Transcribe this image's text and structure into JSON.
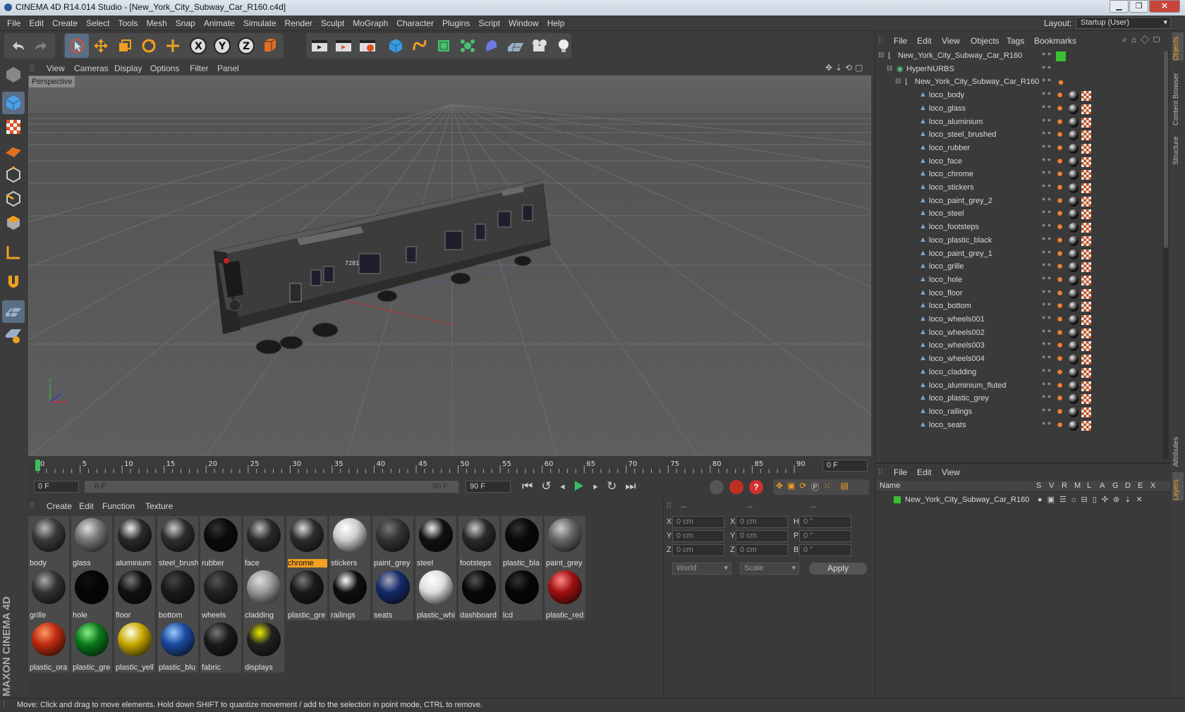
{
  "app": {
    "title": "CINEMA 4D R14.014 Studio - [New_York_City_Subway_Car_R160.c4d]",
    "layout_label": "Layout:",
    "layout_value": "Startup (User)"
  },
  "menu": [
    "File",
    "Edit",
    "Create",
    "Select",
    "Tools",
    "Mesh",
    "Snap",
    "Animate",
    "Simulate",
    "Render",
    "Sculpt",
    "MoGraph",
    "Character",
    "Plugins",
    "Script",
    "Window",
    "Help"
  ],
  "viewport": {
    "menu": [
      "View",
      "Cameras",
      "Display",
      "Options",
      "Filter",
      "Panel"
    ],
    "label": "Perspective",
    "car_number": "7281"
  },
  "timeline": {
    "ticks": [
      "0",
      "5",
      "10",
      "15",
      "20",
      "25",
      "30",
      "35",
      "40",
      "45",
      "50",
      "55",
      "60",
      "65",
      "70",
      "75",
      "80",
      "85",
      "90"
    ],
    "frame_field": "0 F",
    "start_field": "0 F",
    "range_start": "0 F",
    "range_end": "90 F",
    "end_field": "90 F"
  },
  "materials": {
    "menu": [
      "Create",
      "Edit",
      "Function",
      "Texture"
    ],
    "items": [
      {
        "label": "body",
        "color": "#3a3a3a",
        "shine": "#bbb"
      },
      {
        "label": "glass",
        "color": "#777",
        "shine": "#ddd"
      },
      {
        "label": "aluminium",
        "color": "#2a2a2a",
        "shine": "#eee"
      },
      {
        "label": "steel_brush",
        "color": "#2e2e2e",
        "shine": "#ccc"
      },
      {
        "label": "rubber",
        "color": "#0a0a0a",
        "shine": "#333"
      },
      {
        "label": "face",
        "color": "#2a2a2a",
        "shine": "#bbb"
      },
      {
        "label": "chrome",
        "color": "#2d2d2d",
        "shine": "#ddd",
        "selected": true
      },
      {
        "label": "stickers",
        "color": "#ccc",
        "shine": "#fff"
      },
      {
        "label": "paint_grey",
        "color": "#333",
        "shine": "#777"
      },
      {
        "label": "steel",
        "color": "#111",
        "shine": "#eee"
      },
      {
        "label": "footsteps",
        "color": "#2a2a2a",
        "shine": "#ccc"
      },
      {
        "label": "plastic_bla",
        "color": "#080808",
        "shine": "#333"
      },
      {
        "label": "paint_grey",
        "color": "#666",
        "shine": "#ccc"
      },
      {
        "label": "grille",
        "color": "#333",
        "shine": "#aaa"
      },
      {
        "label": "hole",
        "color": "#050505",
        "shine": "#111"
      },
      {
        "label": "floor",
        "color": "#111",
        "shine": "#777"
      },
      {
        "label": "bottom",
        "color": "#1a1a1a",
        "shine": "#444"
      },
      {
        "label": "wheels",
        "color": "#222",
        "shine": "#555"
      },
      {
        "label": "cladding",
        "color": "#999",
        "shine": "#ddd"
      },
      {
        "label": "plastic_gre",
        "color": "#1a1a1a",
        "shine": "#777"
      },
      {
        "label": "railings",
        "color": "#0e0e0e",
        "shine": "#fff"
      },
      {
        "label": "seats",
        "color": "#152a6a",
        "shine": "#aab"
      },
      {
        "label": "plastic_whi",
        "color": "#ddd",
        "shine": "#fff"
      },
      {
        "label": "dashboard",
        "color": "#080808",
        "shine": "#555"
      },
      {
        "label": "lcd",
        "color": "#050505",
        "shine": "#333"
      },
      {
        "label": "plastic_red",
        "color": "#a01010",
        "shine": "#f88"
      },
      {
        "label": "plastic_ora",
        "color": "#c02a10",
        "shine": "#f96"
      },
      {
        "label": "plastic_gre",
        "color": "#0a7a1a",
        "shine": "#8e8"
      },
      {
        "label": "plastic_yell",
        "color": "#c8a800",
        "shine": "#ffe"
      },
      {
        "label": "plastic_blu",
        "color": "#1a4aa0",
        "shine": "#9cf"
      },
      {
        "label": "fabric",
        "color": "#1a1a1a",
        "shine": "#777"
      },
      {
        "label": "displays",
        "color": "#222",
        "shine": "#ee0"
      }
    ]
  },
  "coords": {
    "header": "--",
    "col_headers": [
      "--",
      "--"
    ],
    "rows": [
      {
        "a": "X",
        "av": "0 cm",
        "b": "X",
        "bv": "0 cm",
        "c": "H",
        "cv": "0 °"
      },
      {
        "a": "Y",
        "av": "0 cm",
        "b": "Y",
        "bv": "0 cm",
        "c": "P",
        "cv": "0 °"
      },
      {
        "a": "Z",
        "av": "0 cm",
        "b": "Z",
        "bv": "0 cm",
        "c": "B",
        "cv": "0 °"
      }
    ],
    "world": "World",
    "scale": "Scale",
    "apply": "Apply"
  },
  "objects": {
    "menu": [
      "File",
      "Edit",
      "View",
      "Objects",
      "Tags",
      "Bookmarks"
    ],
    "root": "New_York_City_Subway_Car_R160",
    "hypernurbs": "HyperNURBS",
    "group": "New_York_City_Subway_Car_R160",
    "children": [
      "loco_body",
      "loco_glass",
      "loco_aluminium",
      "loco_steel_brushed",
      "loco_rubber",
      "loco_face",
      "loco_chrome",
      "loco_stickers",
      "loco_paint_grey_2",
      "loco_steel",
      "loco_footsteps",
      "loco_plastic_black",
      "loco_paint_grey_1",
      "loco_grille",
      "loco_hole",
      "loco_floor",
      "loco_bottom",
      "loco_wheels001",
      "loco_wheels002",
      "loco_wheels003",
      "loco_wheels004",
      "loco_cladding",
      "loco_aluminium_fluted",
      "loco_plastic_grey",
      "loco_railings",
      "loco_seats"
    ]
  },
  "layers": {
    "menu": [
      "File",
      "Edit",
      "View"
    ],
    "name_header": "Name",
    "cols": [
      "S",
      "V",
      "R",
      "M",
      "L",
      "A",
      "G",
      "D",
      "E",
      "X"
    ],
    "row": "New_York_City_Subway_Car_R160"
  },
  "side_tabs": [
    "Objects",
    "Content Browser",
    "Structure",
    "Attributes",
    "Layers"
  ],
  "status": "Move: Click and drag to move elements. Hold down SHIFT to quantize movement / add to the selection in point mode, CTRL to remove.",
  "brand": "MAXON CINEMA 4D"
}
